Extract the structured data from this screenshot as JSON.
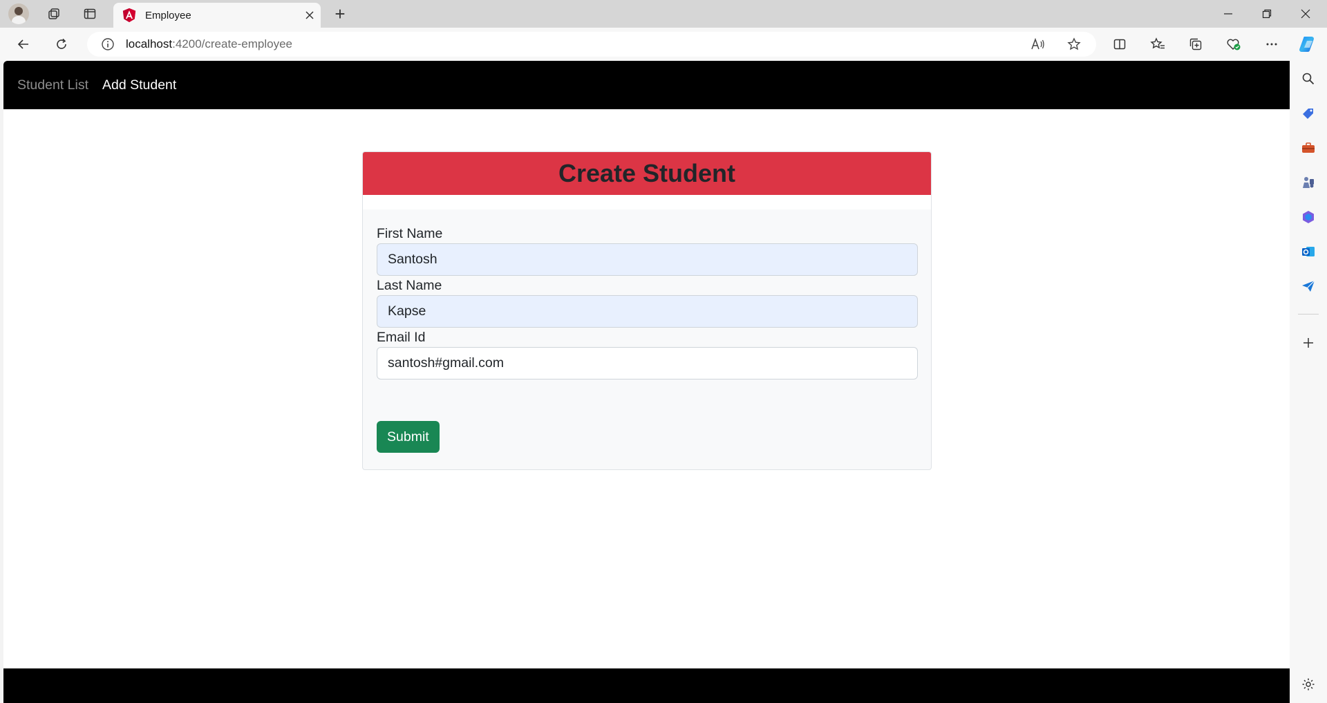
{
  "browser": {
    "tab_title": "Employee",
    "new_tab_symbol": "+",
    "address": {
      "host": "localhost",
      "path": ":4200/create-employee"
    }
  },
  "app": {
    "nav": {
      "items": [
        {
          "label": "Student List",
          "active": false
        },
        {
          "label": "Add Student",
          "active": true
        }
      ]
    },
    "form": {
      "title": "Create Student",
      "fields": {
        "first_name": {
          "label": "First Name",
          "value": "Santosh"
        },
        "last_name": {
          "label": "Last Name",
          "value": "Kapse"
        },
        "email": {
          "label": "Email Id",
          "value": "santosh#gmail.com"
        }
      },
      "submit_label": "Submit"
    }
  },
  "colors": {
    "header_red": "#dc3545",
    "submit_green": "#198754",
    "navbar_black": "#000000",
    "autofill_blue": "#e8f0fe"
  },
  "icons": {
    "browser": [
      "profile-avatar",
      "workspaces-icon",
      "tab-actions-icon",
      "angular-logo-icon",
      "close-icon",
      "plus-icon",
      "minimize-icon",
      "restore-icon",
      "window-close-icon",
      "back-icon",
      "refresh-icon",
      "info-icon",
      "read-aloud-icon",
      "favorite-star-icon",
      "split-screen-icon",
      "favorites-icon",
      "collections-icon",
      "browser-essentials-icon",
      "more-icon",
      "copilot-icon"
    ],
    "sidebar": [
      "search-icon",
      "shopping-tag-icon",
      "tools-icon",
      "games-icon",
      "office-icon",
      "outlook-icon",
      "send-icon",
      "add-icon",
      "settings-icon"
    ]
  }
}
